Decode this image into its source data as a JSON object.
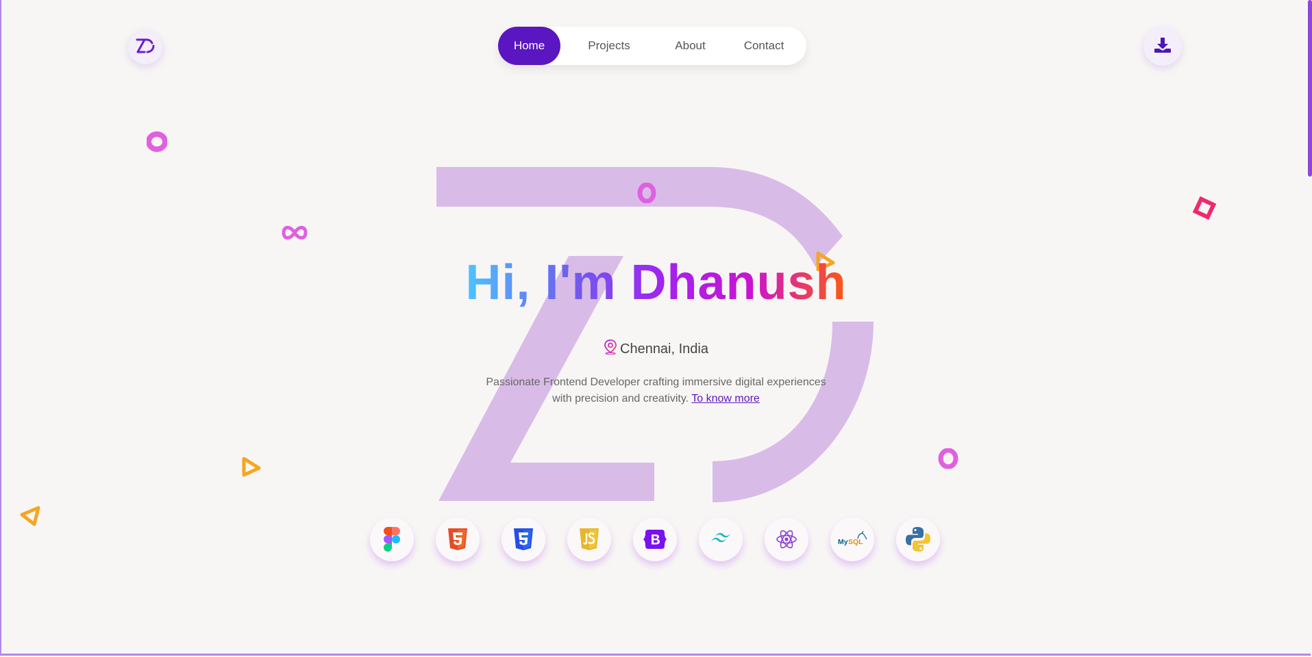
{
  "nav": {
    "items": [
      {
        "label": "Home",
        "active": true
      },
      {
        "label": "Projects",
        "active": false
      },
      {
        "label": "About",
        "active": false
      },
      {
        "label": "Contact",
        "active": false
      }
    ]
  },
  "header": {
    "logo_icon": "dz-logo-icon",
    "download_icon": "download-icon"
  },
  "hero": {
    "title": "Hi, I'm Dhanush",
    "location_icon": "location-pin-icon",
    "location": "Chennai, India",
    "description": "Passionate Frontend Developer crafting immersive digital experiences with precision and creativity.",
    "link_label": "To know more"
  },
  "skills": [
    {
      "name": "figma-icon"
    },
    {
      "name": "html5-icon"
    },
    {
      "name": "css3-icon"
    },
    {
      "name": "javascript-icon"
    },
    {
      "name": "bootstrap-icon"
    },
    {
      "name": "tailwind-icon"
    },
    {
      "name": "react-icon"
    },
    {
      "name": "mysql-icon",
      "text": "MySQL"
    },
    {
      "name": "python-icon"
    }
  ],
  "colors": {
    "accent": "#5a16c0",
    "background": "#f8f6f5",
    "bg_logo": "#d9bbe8"
  }
}
